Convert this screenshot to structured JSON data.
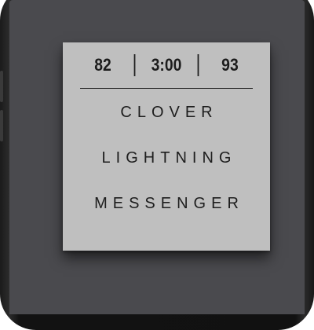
{
  "header": {
    "left_value": "82",
    "center_value": "3:00",
    "right_value": "93"
  },
  "menu": {
    "items": [
      {
        "label": "CLOVER"
      },
      {
        "label": "LIGHTNING"
      },
      {
        "label": "MESSENGER"
      }
    ]
  },
  "colors": {
    "screen_background": "#4a4a4e",
    "card_background": "#bfbfbf",
    "text": "#1e1e1e",
    "phone_frame": "#151515"
  }
}
